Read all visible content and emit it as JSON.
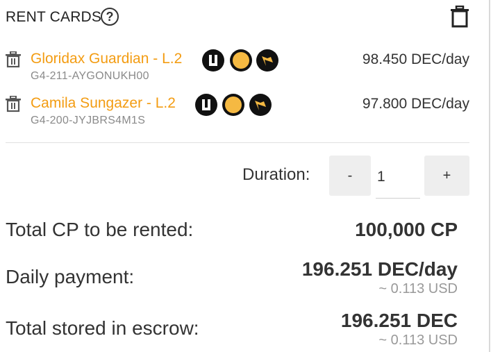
{
  "header": {
    "title": "RENT CARDS",
    "help_icon": "?"
  },
  "cards": [
    {
      "name": "Gloridax Guardian - L.2",
      "uid": "G4-211-AYGONUKH00",
      "price": "98.450 DEC/day"
    },
    {
      "name": "Camila Sungazer - L.2",
      "uid": "G4-200-JYJBRS4M1S",
      "price": "97.800 DEC/day"
    }
  ],
  "duration": {
    "label": "Duration:",
    "minus_label": "-",
    "plus_label": "+",
    "value": "1"
  },
  "summary": {
    "cp_label": "Total CP to be rented:",
    "cp_value": "100,000 CP",
    "daily_label": "Daily payment:",
    "daily_value": "196.251 DEC/day",
    "daily_usd": "~ 0.113 USD",
    "escrow_label": "Total stored in escrow:",
    "escrow_value": "196.251 DEC",
    "escrow_usd": "~ 0.113 USD"
  },
  "colors": {
    "card_name": "#f39c12",
    "badge_gold": "#f5b942",
    "badge_dark": "#111111"
  },
  "icons": [
    "help-icon",
    "trash-icon",
    "edition-badge-icon",
    "foil-badge-icon",
    "element-badge-icon"
  ]
}
